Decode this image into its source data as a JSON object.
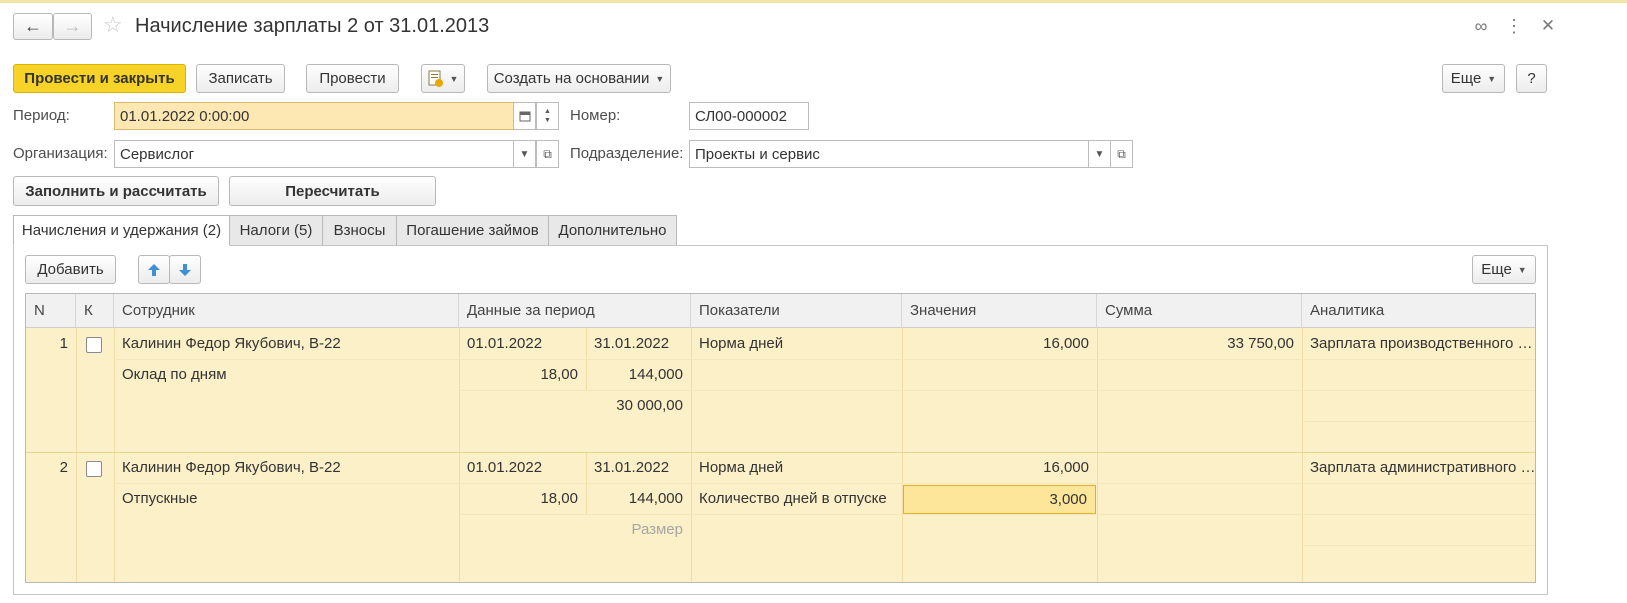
{
  "window": {
    "title": "Начисление зарплаты 2 от 31.01.2013",
    "back_glyph": "←",
    "forward_glyph": "→",
    "star_glyph": "☆",
    "link_glyph": "∞",
    "more_glyph": "⋮",
    "close_glyph": "✕"
  },
  "toolbar": {
    "post_close": "Провести и закрыть",
    "save": "Записать",
    "post": "Провести",
    "create_based": "Создать на основании",
    "more": "Еще",
    "help": "?"
  },
  "form": {
    "period_label": "Период:",
    "period_value": "01.01.2022 0:00:00",
    "number_label": "Номер:",
    "number_value": "СЛ00-000002",
    "org_label": "Организация:",
    "org_value": "Сервислог",
    "dept_label": "Подразделение:",
    "dept_value": "Проекты и сервис"
  },
  "actions": {
    "fill_calc": "Заполнить и рассчитать",
    "recalc": "Пересчитать"
  },
  "tabs": [
    {
      "label": "Начисления и удержания (2)"
    },
    {
      "label": "Налоги (5)"
    },
    {
      "label": "Взносы"
    },
    {
      "label": "Погашение займов"
    },
    {
      "label": "Дополнительно"
    }
  ],
  "table_toolbar": {
    "add": "Добавить",
    "more": "Еще"
  },
  "table": {
    "headers": [
      "N",
      "К",
      "Сотрудник",
      "Данные за период",
      "Показатели",
      "Значения",
      "Сумма",
      "Аналитика"
    ],
    "rows": [
      {
        "n": "1",
        "employee": "Калинин Федор Якубович, В-22",
        "accrual": "Оклад по дням",
        "date_from": "01.01.2022",
        "date_to": "31.01.2022",
        "days": "18,00",
        "hours": "144,000",
        "base": "30 000,00",
        "indicator1": "Норма дней",
        "value1": "16,000",
        "indicator2": "",
        "value2": "",
        "sum": "33 750,00",
        "analytics": "Зарплата производственного …"
      },
      {
        "n": "2",
        "employee": "Калинин Федор Якубович, В-22",
        "accrual": "Отпускные",
        "date_from": "01.01.2022",
        "date_to": "31.01.2022",
        "days": "18,00",
        "hours": "144,000",
        "base": "Размер",
        "indicator1": "Норма дней",
        "value1": "16,000",
        "indicator2": "Количество дней в отпуске",
        "value2": "3,000",
        "sum": "",
        "analytics": "Зарплата административного …"
      }
    ]
  }
}
